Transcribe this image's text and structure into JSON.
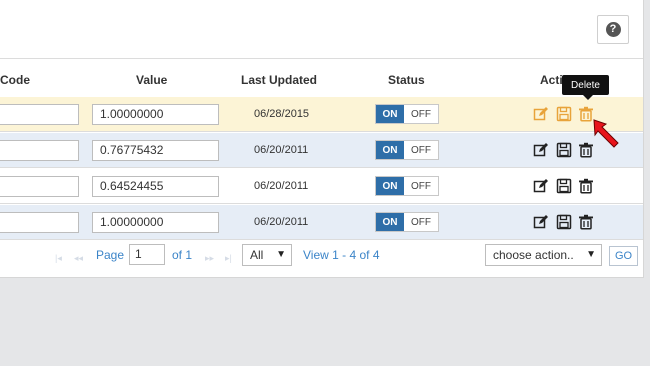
{
  "help": {
    "glyph": "?",
    "icon": "question-circle-icon"
  },
  "table": {
    "columns": {
      "code": "Code",
      "value": "Value",
      "last_updated": "Last Updated",
      "status": "Status",
      "actions": "Acti"
    },
    "rows": [
      {
        "code": "",
        "value": "1.00000000",
        "date": "06/28/2015",
        "on": "ON",
        "off": "OFF",
        "highlight": "yellow"
      },
      {
        "code": "",
        "value": "0.76775432",
        "date": "06/20/2011",
        "on": "ON",
        "off": "OFF",
        "highlight": "blue"
      },
      {
        "code": "",
        "value": "0.64524455",
        "date": "06/20/2011",
        "on": "ON",
        "off": "OFF",
        "highlight": "white"
      },
      {
        "code": "",
        "value": "1.00000000",
        "date": "06/20/2011",
        "on": "ON",
        "off": "OFF",
        "highlight": "blue"
      }
    ]
  },
  "tooltip": {
    "text": "Delete"
  },
  "pagination": {
    "page_label": "Page",
    "page_value": "1",
    "of_label": "of 1",
    "per_page": "All",
    "view_text": "View 1 - 4 of 4",
    "first_icon": "first-page-icon",
    "prev_icon": "prev-page-icon",
    "next_icon": "next-page-icon",
    "last_icon": "last-page-icon"
  },
  "bulk": {
    "select_value": "choose action..",
    "go_label": "GO"
  },
  "colors": {
    "toggle_on": "#2e6ea8",
    "highlight_row": "#fcf4d6",
    "alt_row": "#e6edf6",
    "active_icon": "#e8a33a",
    "cursor": "#e8141b"
  }
}
